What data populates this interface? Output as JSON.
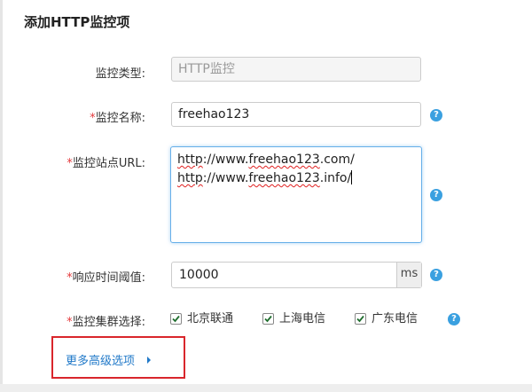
{
  "form": {
    "title": "添加HTTP监控项",
    "type": {
      "label": "监控类型:",
      "value": "HTTP监控",
      "required": false
    },
    "name": {
      "label": "监控名称:",
      "value": "freehao123",
      "required": true,
      "required_mark": "*"
    },
    "url": {
      "label": "监控站点URL:",
      "required_mark": "*",
      "lines": [
        "http://www.freehao123.com/",
        "http://www.freehao123.info/"
      ],
      "line1_scheme": "http",
      "line1_rest": "://www.",
      "line1_domain": "freehao123",
      "line1_tail": ".com/",
      "line2_scheme": "http",
      "line2_rest": "://www.",
      "line2_domain": "freehao123",
      "line2_tail": ".info/"
    },
    "threshold": {
      "label": "响应时间阈值:",
      "value": "10000",
      "unit": "ms",
      "required_mark": "*"
    },
    "cluster": {
      "label": "监控集群选择:",
      "required_mark": "*",
      "options": [
        {
          "label": "北京联通",
          "checked": true
        },
        {
          "label": "上海电信",
          "checked": true
        },
        {
          "label": "广东电信",
          "checked": true
        }
      ]
    },
    "advanced_link": "更多高级选项"
  },
  "icons": {
    "help": "help-question-icon",
    "checkbox_check": "check-icon",
    "advanced_arrow": "caret-right-icon"
  },
  "colors": {
    "required": "#e4393c",
    "link": "#1f78c8",
    "help": "#3aa0e0",
    "highlight_border": "#d9262c",
    "focus_border": "#66afe9"
  },
  "help_glyph": "?"
}
